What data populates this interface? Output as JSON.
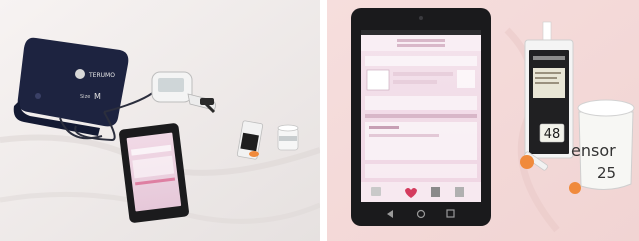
{
  "photos": {
    "left": {
      "cuff_brand": "TERUMO",
      "cuff_size": "M",
      "cuff_size_prefix": "Size"
    },
    "right": {
      "meter_reading": "48",
      "sensor_label": "ensor",
      "sensor_count": "25"
    }
  }
}
